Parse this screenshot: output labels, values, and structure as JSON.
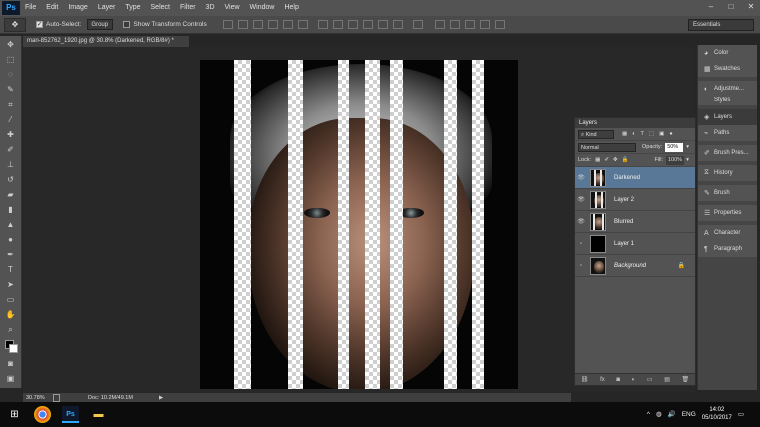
{
  "app": {
    "logo": "Ps"
  },
  "menu": [
    "File",
    "Edit",
    "Image",
    "Layer",
    "Type",
    "Select",
    "Filter",
    "3D",
    "View",
    "Window",
    "Help"
  ],
  "window_controls": [
    "–",
    "□",
    "✕"
  ],
  "options": {
    "auto_select_label": "Auto-Select:",
    "auto_select_value": "Group",
    "transform_label": "Show Transform Controls",
    "workspace": "Essentials"
  },
  "document": {
    "tab_title": "man-852762_1920.jpg @ 30.8% (Darkened, RGB/8#) *",
    "zoom": "30.78%",
    "doc_size": "Doc: 10.2M/49.1M"
  },
  "right_dock": {
    "group1": [
      {
        "icon": "palette-icon",
        "label": "Color"
      },
      {
        "icon": "swatches-icon",
        "label": "Swatches"
      }
    ],
    "group2": [
      {
        "icon": "adjustments-icon",
        "label": "Adjustme..."
      },
      {
        "icon": "styles-icon",
        "label": "Styles"
      }
    ],
    "group3": [
      {
        "icon": "layers-icon",
        "label": "Layers"
      },
      {
        "icon": "paths-icon",
        "label": "Paths"
      }
    ],
    "group4": [
      {
        "icon": "brush-presets-icon",
        "label": "Brush Pres..."
      }
    ],
    "group5": [
      {
        "icon": "history-icon",
        "label": "History"
      }
    ],
    "group6": [
      {
        "icon": "brush-icon",
        "label": "Brush"
      }
    ],
    "group7": [
      {
        "icon": "properties-icon",
        "label": "Properties"
      }
    ],
    "group8": [
      {
        "icon": "character-icon",
        "label": "Character"
      },
      {
        "icon": "paragraph-icon",
        "label": "Paragraph"
      }
    ]
  },
  "layers_panel": {
    "tab": "Layers",
    "filter": "Kind",
    "blend_mode": "Normal",
    "opacity_label": "Opacity:",
    "opacity_value": "50%",
    "lock_label": "Lock:",
    "fill_label": "Fill:",
    "fill_value": "100%",
    "layers": [
      {
        "name": "Darkened",
        "visible": true,
        "selected": true
      },
      {
        "name": "Layer 2",
        "visible": true,
        "selected": false
      },
      {
        "name": "Blurred",
        "visible": true,
        "selected": false
      },
      {
        "name": "Layer 1",
        "visible": false,
        "selected": false
      },
      {
        "name": "Background",
        "visible": false,
        "selected": false,
        "locked": true
      }
    ],
    "footer_icons": [
      "link-icon",
      "fx-icon",
      "mask-icon",
      "adjustment-icon",
      "folder-icon",
      "new-layer-icon",
      "trash-icon"
    ]
  },
  "taskbar": {
    "language": "ENG",
    "time": "14:02",
    "date": "05/10/2017"
  },
  "colors": {
    "selected_layer": "#597796",
    "accent": "#31a8ff"
  }
}
